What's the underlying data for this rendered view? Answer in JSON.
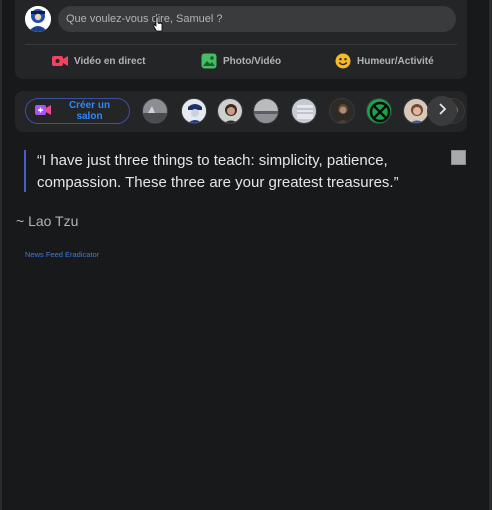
{
  "composer": {
    "placeholder": "Que voulez-vous dire, Samuel ?",
    "actions": [
      {
        "label": "Vidéo en direct",
        "icon": "live-video-icon",
        "color": "#f3425f"
      },
      {
        "label": "Photo/Vidéo",
        "icon": "photo-video-icon",
        "color": "#45bd62"
      },
      {
        "label": "Humeur/Activité",
        "icon": "feeling-activity-icon",
        "color": "#f7b928"
      }
    ]
  },
  "stories": {
    "create_room_label": "Créer un salon",
    "create_room_icon": "video-room-plus-icon",
    "next_icon": "chevron-right-icon"
  },
  "quote": {
    "text": "“I have just three things to teach: simplicity, patience, compassion. These three are your greatest treasures.”",
    "author": "~ Lao Tzu"
  },
  "footer": {
    "link_label": "News Feed Eradicator"
  },
  "colors": {
    "background": "#18191a",
    "surface": "#242526",
    "accent": "#2d88ff",
    "quote_bar": "#4b5cc4"
  }
}
